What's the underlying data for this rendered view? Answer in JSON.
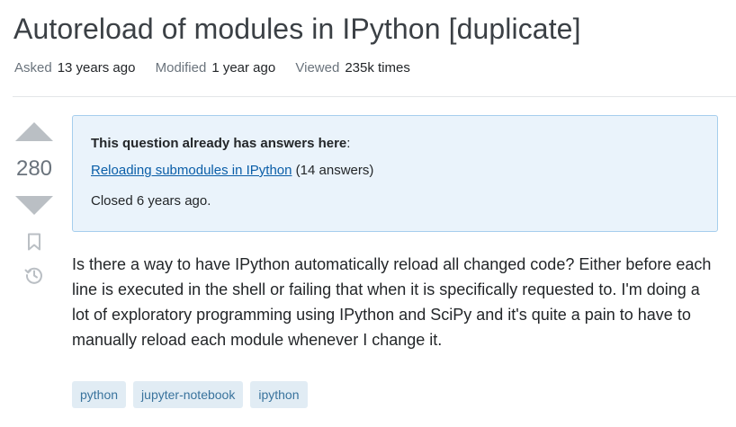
{
  "question": {
    "title": "Autoreload of modules in IPython [duplicate]",
    "meta": {
      "asked_label": "Asked",
      "asked_value": "13 years ago",
      "modified_label": "Modified",
      "modified_value": "1 year ago",
      "viewed_label": "Viewed",
      "viewed_value": "235k times"
    },
    "score": "280",
    "body": "Is there a way to have IPython automatically reload all changed code? Either before each line is executed in the shell or failing that when it is specifically requested to. I'm doing a lot of exploratory programming using IPython and SciPy and it's quite a pain to have to manually reload each module whenever I change it."
  },
  "duplicate_notice": {
    "heading": "This question already has answers here",
    "heading_suffix": ":",
    "link_text": "Reloading submodules in IPython",
    "link_count": "(14 answers)",
    "closed_text": "Closed 6 years ago."
  },
  "vote_controls": {
    "icons": [
      "upvote-arrow-icon",
      "downvote-arrow-icon",
      "bookmark-icon",
      "history-icon"
    ]
  },
  "tags": [
    "python",
    "jupyter-notebook",
    "ipython"
  ],
  "colors": {
    "link": "#0a5ea8",
    "notice_bg": "#eaf3fb",
    "notice_border": "#a6ceed",
    "tag_bg": "#e1ecf4",
    "tag_text": "#39739d",
    "vote_arrow": "#babfc4"
  }
}
